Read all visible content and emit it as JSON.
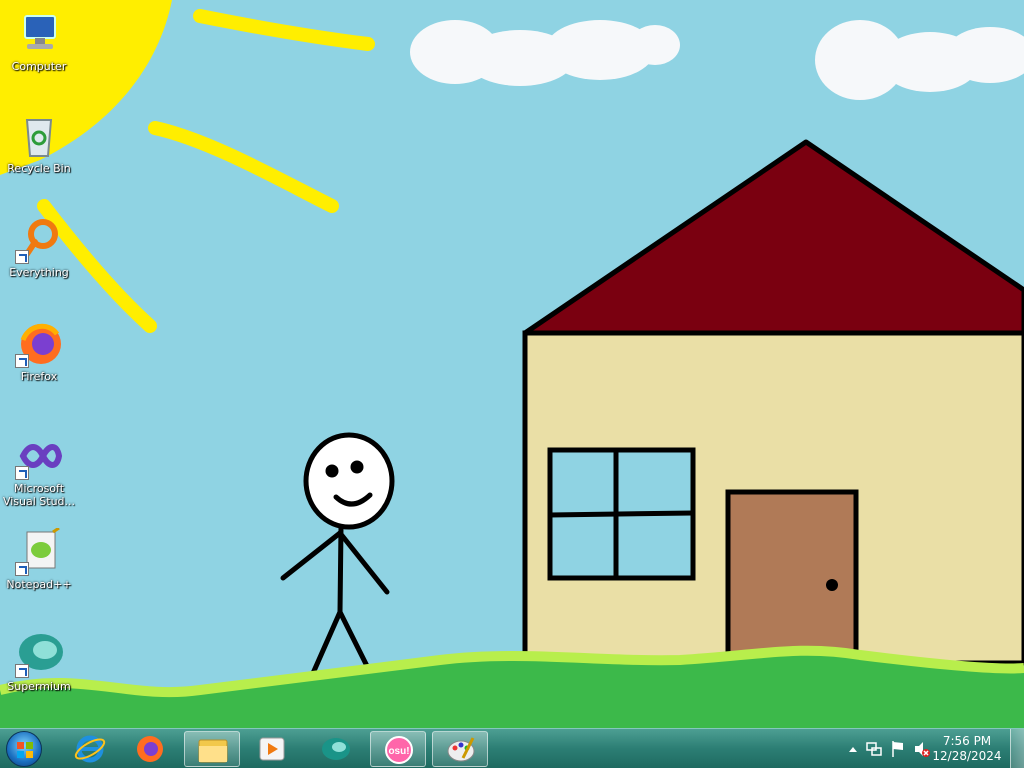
{
  "desktop": {
    "icons": [
      {
        "label": "Computer",
        "icon": "computer-icon"
      },
      {
        "label": "Recycle Bin",
        "icon": "recycle-bin-icon"
      },
      {
        "label": "Everything",
        "icon": "everything-search-icon"
      },
      {
        "label": "Firefox",
        "icon": "firefox-icon"
      },
      {
        "label": "Microsoft Visual Stud...",
        "icon": "visual-studio-icon"
      },
      {
        "label": "Notepad++",
        "icon": "notepad-plus-plus-icon"
      },
      {
        "label": "Supermium",
        "icon": "supermium-icon"
      }
    ]
  },
  "taskbar": {
    "pinned": [
      {
        "icon": "start-orb-icon"
      },
      {
        "icon": "internet-explorer-icon"
      },
      {
        "icon": "firefox-icon"
      },
      {
        "icon": "file-explorer-icon"
      },
      {
        "icon": "media-player-icon"
      },
      {
        "icon": "supermium-icon"
      },
      {
        "icon": "osu-icon",
        "label": "osu!"
      },
      {
        "icon": "paint-icon"
      }
    ],
    "tray": {
      "time": "7:56 PM",
      "date": "12/28/2024"
    }
  },
  "colors": {
    "sky": "#8fd3e3",
    "grass": "#3cb94a",
    "roof": "#7a0010",
    "wall": "#eadfa6",
    "door": "#b07a57",
    "sun": "#ffee00",
    "taskbar": "#2c7e74"
  }
}
